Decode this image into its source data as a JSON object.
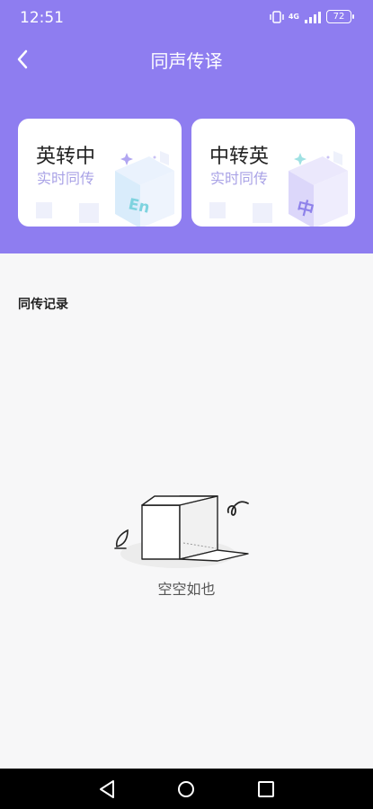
{
  "status": {
    "time": "12:51",
    "network": "4G",
    "battery": "72"
  },
  "header": {
    "title": "同声传译"
  },
  "cards": [
    {
      "title": "英转中",
      "subtitle": "实时同传",
      "badge": "En"
    },
    {
      "title": "中转英",
      "subtitle": "实时同传",
      "badge": "中"
    }
  ],
  "records": {
    "title": "同传记录",
    "empty_text": "空空如也"
  },
  "colors": {
    "brand": "#8e7df0",
    "card_subtitle": "#a9a2e6",
    "page_bg": "#f7f7f8"
  }
}
